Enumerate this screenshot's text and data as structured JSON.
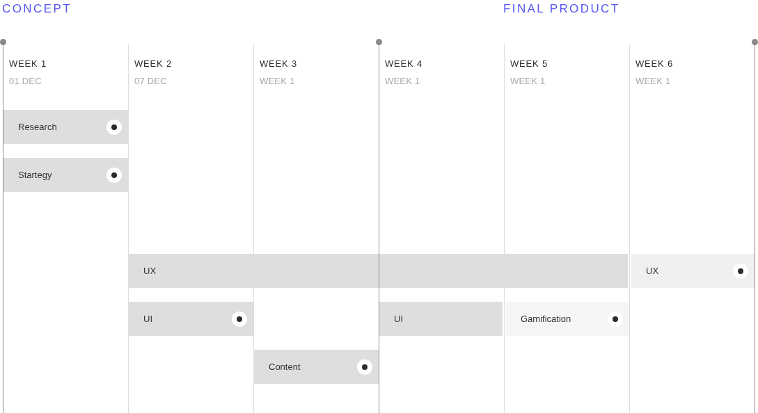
{
  "weeks": [
    {
      "phase": "CONCEPT",
      "milestone": true,
      "title": "WEEK 1",
      "subtitle": "01 DEC"
    },
    {
      "milestone": false,
      "title": "WEEK 2",
      "subtitle": "07 DEC"
    },
    {
      "milestone": false,
      "title": "WEEK 3",
      "subtitle": "WEEK 1"
    },
    {
      "milestone": true,
      "title": "WEEK 4",
      "subtitle": "WEEK 1"
    },
    {
      "phase": "FINAL PRODUCT",
      "milestone": false,
      "title": "WEEK 5",
      "subtitle": "WEEK 1"
    },
    {
      "milestone": false,
      "title": "WEEK 6",
      "subtitle": "WEEK 1"
    }
  ],
  "end_milestone": true,
  "lanes": [
    {
      "cells": [
        {
          "kind": "task",
          "label": "Research",
          "marker": true,
          "color": "#dedede"
        },
        {
          "kind": "empty"
        },
        {
          "kind": "empty"
        },
        {
          "kind": "empty"
        },
        {
          "kind": "empty"
        },
        {
          "kind": "empty"
        }
      ]
    },
    {
      "cells": [
        {
          "kind": "task",
          "label": "Startegy",
          "marker": true,
          "color": "#dedede"
        },
        {
          "kind": "empty"
        },
        {
          "kind": "empty"
        },
        {
          "kind": "empty"
        },
        {
          "kind": "empty"
        },
        {
          "kind": "empty"
        }
      ]
    },
    {
      "cells": [
        {
          "kind": "empty"
        },
        {
          "kind": "empty"
        },
        {
          "kind": "empty"
        },
        {
          "kind": "empty"
        },
        {
          "kind": "empty"
        },
        {
          "kind": "empty"
        }
      ]
    },
    {
      "cells": [
        {
          "kind": "empty"
        },
        {
          "kind": "task",
          "label": "UX",
          "marker": false,
          "color": "#dedede"
        },
        {
          "kind": "continued"
        },
        {
          "kind": "continued"
        },
        {
          "kind": "continued"
        },
        {
          "kind": "task",
          "label": "UX",
          "marker": true,
          "color": "#f0f0f0"
        }
      ]
    },
    {
      "cells": [
        {
          "kind": "empty"
        },
        {
          "kind": "task",
          "label": "UI",
          "marker": true,
          "color": "#dedede"
        },
        {
          "kind": "empty"
        },
        {
          "kind": "task",
          "label": "UI",
          "marker": false,
          "color": "#dedede"
        },
        {
          "kind": "task",
          "label": "Gamification",
          "marker": true,
          "color": "#f5f5f5"
        },
        {
          "kind": "empty"
        }
      ]
    },
    {
      "cells": [
        {
          "kind": "empty"
        },
        {
          "kind": "empty"
        },
        {
          "kind": "task",
          "label": "Content",
          "marker": true,
          "color": "#dedede"
        },
        {
          "kind": "empty"
        },
        {
          "kind": "empty"
        },
        {
          "kind": "empty"
        }
      ]
    }
  ]
}
